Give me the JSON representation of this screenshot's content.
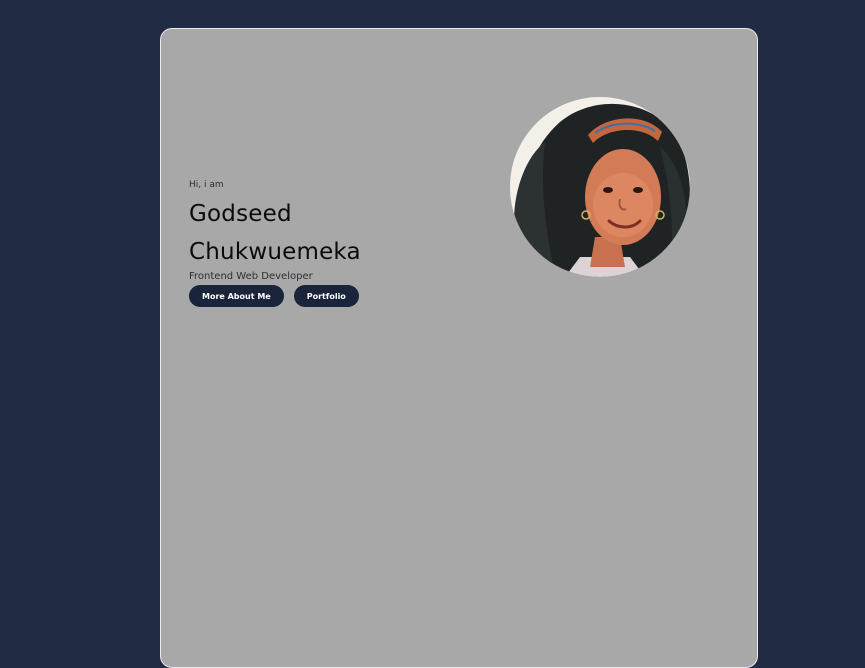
{
  "hero": {
    "greeting": "Hi, i am",
    "name_first": "Godseed",
    "name_last": "Chukwuemeka",
    "role": "Frontend Web Developer",
    "buttons": {
      "about": "More About Me",
      "portfolio": "Portfolio"
    }
  },
  "colors": {
    "page_background": "#212c44",
    "card_background": "#a7a8a7",
    "button_background": "#1a243a",
    "button_text": "#ffffff"
  }
}
